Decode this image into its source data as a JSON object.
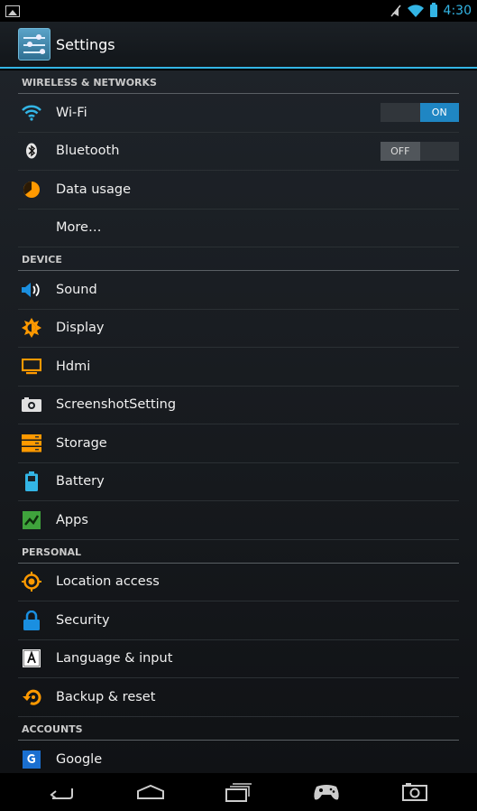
{
  "status_bar": {
    "time": "4:30"
  },
  "action_bar": {
    "title": "Settings"
  },
  "sections": [
    {
      "header": "WIRELESS & NETWORKS",
      "items": [
        {
          "label": "Wi-Fi",
          "icon": "wifi-icon",
          "toggle": "ON"
        },
        {
          "label": "Bluetooth",
          "icon": "bluetooth-icon",
          "toggle": "OFF"
        },
        {
          "label": "Data usage",
          "icon": "data-usage-icon"
        },
        {
          "label": "More…",
          "icon": ""
        }
      ]
    },
    {
      "header": "DEVICE",
      "items": [
        {
          "label": "Sound",
          "icon": "speaker-icon"
        },
        {
          "label": "Display",
          "icon": "brightness-icon"
        },
        {
          "label": "Hdmi",
          "icon": "monitor-icon"
        },
        {
          "label": "ScreenshotSetting",
          "icon": "camera-icon"
        },
        {
          "label": "Storage",
          "icon": "storage-icon"
        },
        {
          "label": "Battery",
          "icon": "battery-icon"
        },
        {
          "label": "Apps",
          "icon": "apps-icon"
        }
      ]
    },
    {
      "header": "PERSONAL",
      "items": [
        {
          "label": "Location access",
          "icon": "location-icon"
        },
        {
          "label": "Security",
          "icon": "lock-icon"
        },
        {
          "label": "Language & input",
          "icon": "keyboard-icon"
        },
        {
          "label": "Backup & reset",
          "icon": "backup-icon"
        }
      ]
    },
    {
      "header": "ACCOUNTS",
      "items": [
        {
          "label": "Google",
          "icon": "google-icon"
        }
      ]
    }
  ],
  "colors": {
    "accent": "#33b5e5",
    "toggle_on": "#1f86c3",
    "orange": "#ff9900",
    "blue": "#1a8fe0",
    "green": "#3fa33c"
  }
}
